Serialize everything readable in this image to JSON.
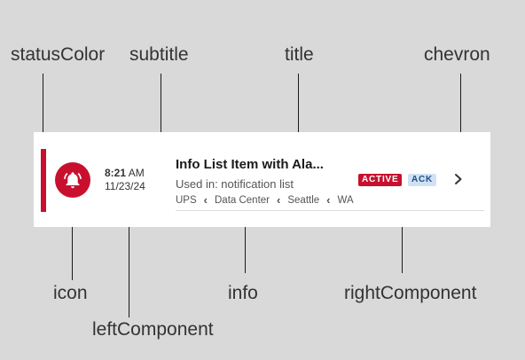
{
  "callouts": {
    "statusColor": "statusColor",
    "subtitle": "subtitle",
    "title": "title",
    "chevron": "chevron",
    "icon": "icon",
    "info": "info",
    "rightComponent": "rightComponent",
    "leftComponent": "leftComponent"
  },
  "list_item": {
    "status_color": "#c8102e",
    "icon": "bell-alert-icon",
    "left_component": {
      "time": "8:21",
      "ampm": "AM",
      "date": "11/23/24"
    },
    "title": "Info List Item with Ala...",
    "subtitle": "Used in: notification list",
    "info": [
      "UPS",
      "Data Center",
      "Seattle",
      "WA"
    ],
    "right_component": {
      "badge_active": "ACTIVE",
      "badge_ack": "ACK"
    },
    "chevron": "chevron-right-icon"
  }
}
